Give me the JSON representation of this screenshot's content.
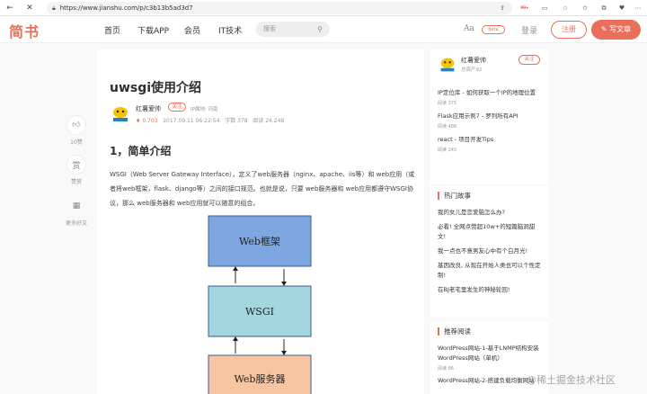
{
  "browser": {
    "url": "https://www.jianshu.com/p/c3b13b5ad3d7",
    "ext_badge": "99+"
  },
  "nav": {
    "logo": "简书",
    "items": [
      "首页",
      "下载APP",
      "会员",
      "IT技术"
    ],
    "search_placeholder": "搜索",
    "font_label": "Aa",
    "diamond_label": "beta",
    "login": "登录",
    "signup": "注册",
    "write": "写文章"
  },
  "leftbar": {
    "likes": "10赞",
    "reward": "赏",
    "reward_label": "赞赏",
    "more": "更多好文"
  },
  "article": {
    "title": "uwsgi使用介绍",
    "author": "红薯爱帅",
    "follow": "关注",
    "ip": "IP属地: 河南",
    "diamond_count": "0.703",
    "date": "2017.09.11 06:22:54",
    "words": "字数 378",
    "reads": "阅读 24,248",
    "heading": "1，简单介绍",
    "paragraph": "WSGI（Web Server Gateway Interface），定义了web服务器（nginx、apache、iis等）和 web应用（或者将web框架，flask、django等）之间的接口规范。也就是说，只要 web服务器和 web应用都遵守WSGI协议，那么 web服务器和 web应用就可以随意的组合。",
    "diagram": {
      "boxes": [
        "Web框架",
        "WSGI",
        "Web服务器"
      ],
      "colors": [
        "#7ea6e0",
        "#a3d6df",
        "#f8c5a2"
      ]
    }
  },
  "sidebar": {
    "author_name": "红薯爱帅",
    "author_assets": "总资产92",
    "follow": "关注",
    "author_posts": [
      {
        "title": "IP定位库 - 如何获取一个IP的地理位置",
        "reads": "阅读 375"
      },
      {
        "title": "Flask应用示例7 - 罗列所有API",
        "reads": "阅读 486"
      },
      {
        "title": "react - 项目开发Tips",
        "reads": "阅读 245"
      }
    ],
    "hot_title": "热门故事",
    "hot_stories": [
      "我的女儿是恋爱脑怎么办?",
      "必看! 全网点赞超10w+的短篇脑洞甜文!",
      "我一点也不意男友心中有个白月光!",
      "基因改良, 从现在开始人类也可以个性定制!",
      "在BJ老宅里发生的神秘轮回!"
    ],
    "recommend_title": "推荐阅读",
    "recommended": [
      {
        "title": "WordPress网站-1-基于LNMP结构安装WordPress网站（单机）",
        "reads": "阅读 86"
      },
      {
        "title": "WordPress网站-2-搭建负载均衡网站",
        "reads": ""
      }
    ]
  },
  "watermark": "@稀土掘金技术社区"
}
